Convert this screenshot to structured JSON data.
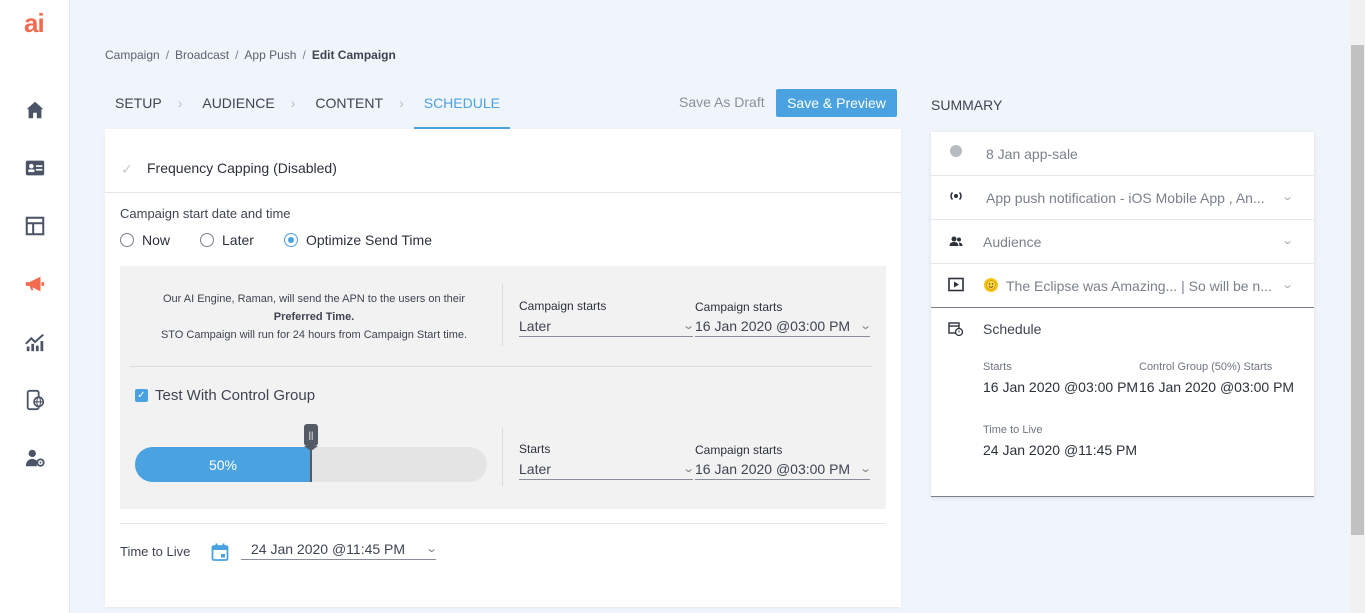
{
  "app": {
    "logo": "ai"
  },
  "sidebar": {
    "items": [
      {
        "name": "home-icon"
      },
      {
        "name": "contact-card-icon"
      },
      {
        "name": "layout-icon"
      },
      {
        "name": "megaphone-icon"
      },
      {
        "name": "analytics-icon"
      },
      {
        "name": "mobile-globe-icon"
      },
      {
        "name": "user-settings-icon"
      }
    ],
    "accent": "#f26b4f"
  },
  "breadcrumb": {
    "items": [
      "Campaign",
      "Broadcast",
      "App Push",
      "Edit Campaign"
    ],
    "sep": "/"
  },
  "steps": [
    "SETUP",
    "AUDIENCE",
    "CONTENT",
    "SCHEDULE"
  ],
  "actions": {
    "draft": "Save As Draft",
    "preview": "Save & Preview"
  },
  "frequency": {
    "label": "Frequency Capping (Disabled)"
  },
  "start": {
    "label": "Campaign start date and time",
    "options": [
      "Now",
      "Later",
      "Optimize Send Time"
    ],
    "selected": "Optimize Send Time"
  },
  "ai": {
    "line1": "Our AI Engine, Raman, will send the APN to the users on their",
    "line2": "Preferred Time.",
    "line3": "STO Campaign will run for 24 hours from Campaign Start time."
  },
  "campaign_starts": {
    "label1": "Campaign starts",
    "value1": "Later",
    "label2": "Campaign starts",
    "value2": "16 Jan 2020 @03:00 PM"
  },
  "control_group": {
    "label": "Test With Control Group",
    "checked": true,
    "percent": 50,
    "percent_text": "50%",
    "handle": "||",
    "starts_label": "Starts",
    "starts_value": "Later",
    "campaign_label": "Campaign starts",
    "campaign_value": "16 Jan 2020 @03:00 PM"
  },
  "ttl": {
    "label": "Time to Live",
    "value": "24 Jan 2020 @11:45 PM"
  },
  "summary": {
    "title": "SUMMARY",
    "rows": [
      {
        "icon": "status-dot-icon",
        "text": "8 Jan app-sale"
      },
      {
        "icon": "broadcast-icon",
        "text": "App push notification - iOS Mobile App , An..."
      },
      {
        "icon": "audience-icon",
        "text": "Audience"
      },
      {
        "icon": "play-icon",
        "text": "The Eclipse was Amazing... | So will be n..."
      }
    ],
    "schedule": {
      "title": "Schedule",
      "starts_label": "Starts",
      "starts_value": "16 Jan 2020 @03:00 PM",
      "cg_label": "Control Group (50%) Starts",
      "cg_value": "16 Jan 2020 @03:00 PM",
      "ttl_label": "Time to Live",
      "ttl_value": "24 Jan 2020 @11:45 PM"
    }
  },
  "colors": {
    "primary": "#4aa3e0",
    "brand": "#f26b4f"
  }
}
